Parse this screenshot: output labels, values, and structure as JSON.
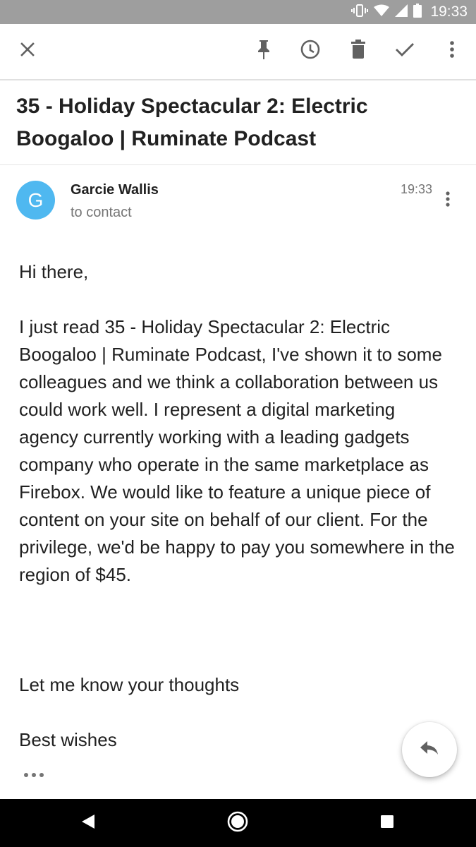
{
  "status_bar": {
    "time": "19:33",
    "icons": [
      "vibrate-icon",
      "wifi-icon",
      "signal-icon",
      "battery-icon"
    ]
  },
  "toolbar": {
    "actions": [
      "close-icon",
      "pin-icon",
      "snooze-icon",
      "delete-icon",
      "done-icon",
      "more-vert-icon"
    ]
  },
  "email": {
    "subject": "35 - Holiday Spectacular 2: Electric Boogaloo | Ruminate Podcast",
    "sender": {
      "initial": "G",
      "name": "Garcie Wallis",
      "recipient": "to contact",
      "time": "19:33",
      "avatar_color": "#4fb8f0"
    },
    "body": {
      "greeting": "Hi there,",
      "paragraph": "I just read 35 - Holiday Spectacular 2: Electric Boogaloo | Ruminate Podcast, I've shown it to some colleagues and we think a collaboration between us could work well. I represent a digital marketing agency currently working with a leading gadgets company who operate in the same marketplace as Firebox. We would like to feature a unique piece of content on your site on behalf of our client. For the privilege, we'd be happy to pay you somewhere in the region of $45.",
      "closing": "Let me know your thoughts",
      "signoff": "Best wishes"
    }
  },
  "fab": {
    "icon": "reply-icon"
  },
  "nav_bar": {
    "buttons": [
      "back-icon",
      "home-icon",
      "recents-icon"
    ]
  },
  "colors": {
    "status_bar_bg": "#9e9e9e",
    "icon_gray": "#616161",
    "text_primary": "#212121",
    "text_secondary": "#757575"
  }
}
